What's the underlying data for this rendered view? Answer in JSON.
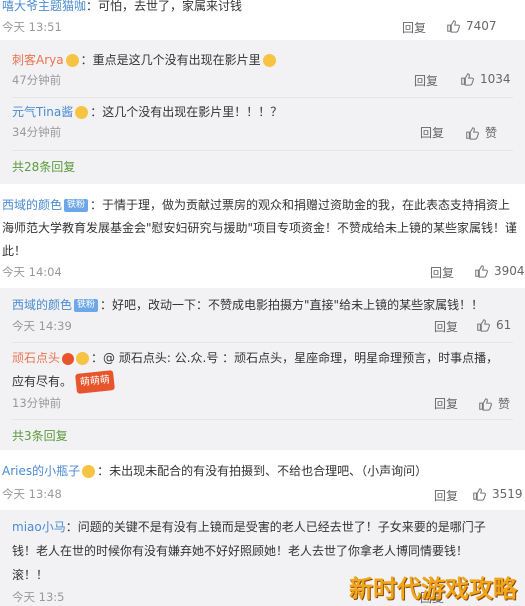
{
  "c0": {
    "name": "嘻大爷主题猫咖",
    "text": "：可怕，去世了，家属来讨钱",
    "time": "今天 13:51",
    "reply": "回复",
    "likes": "7407"
  },
  "r1": {
    "name": "刺客Arya",
    "text": "：重点是这几个没有出现在影片里",
    "time": "47分钟前",
    "reply": "回复",
    "likes": "1034"
  },
  "r2": {
    "name": "元气Tina酱",
    "text": "：这几个没有出现在影片里！！！？",
    "time": "34分钟前",
    "reply": "回复",
    "likes": "赞"
  },
  "more1": "共28条回复",
  "c1": {
    "name": "西域的颜色",
    "tag": "铁粉",
    "line1": "：于情于理，做为贡献过票房的观众和捐赠过资助金的我，在此表态支持捐资上",
    "line2": "海师范大学教育发展基金会\"慰安妇研究与援助\"项目专项资金！不赞成给未上镜的某些家属钱！谨",
    "line3": "此！",
    "time": "今天 14:04",
    "reply": "回复",
    "likes": "3904"
  },
  "r3": {
    "name": "西域的颜色",
    "tag": "铁粉",
    "text": "：好吧，改动一下：不赞成电影拍摄方\"直接\"给未上镜的某些家属钱！！",
    "time": "今天 14:39",
    "reply": "回复",
    "likes": "61"
  },
  "r4": {
    "name": "顽石点头",
    "text": "：@ 顽石点头: 公.众.号 ：顽石点头，星座命理，明星命理预言，时事点播，",
    "line2": "应有尽有。",
    "stamp": "萌萌萌",
    "time": "13分钟前",
    "reply": "回复",
    "likes": "赞"
  },
  "more2": "共3条回复",
  "c2": {
    "name": "Aries的小瓶子",
    "text": "：未出现未配合的有没有拍摄到、不给也合理吧、（小声询问）",
    "time": "今天 13:48",
    "reply": "回复",
    "likes": "3519"
  },
  "r5": {
    "name": "miao小马",
    "line1": "：问题的关键不是有没有上镜而是受害的老人已经去世了！子女来要的是哪门子",
    "line2": "钱！老人在世的时候你有没有嫌弃她不好好照顾她！老人去世了你拿老人博同情要钱！",
    "line3": "滚！！",
    "time": "今天 13:5",
    "reply": "回复"
  },
  "watermark": "新时代游戏攻略",
  "icons": {
    "thumb": "thumbs-up-icon",
    "emoji": "smile-emoji-icon",
    "vip": "vip-badge-icon"
  }
}
